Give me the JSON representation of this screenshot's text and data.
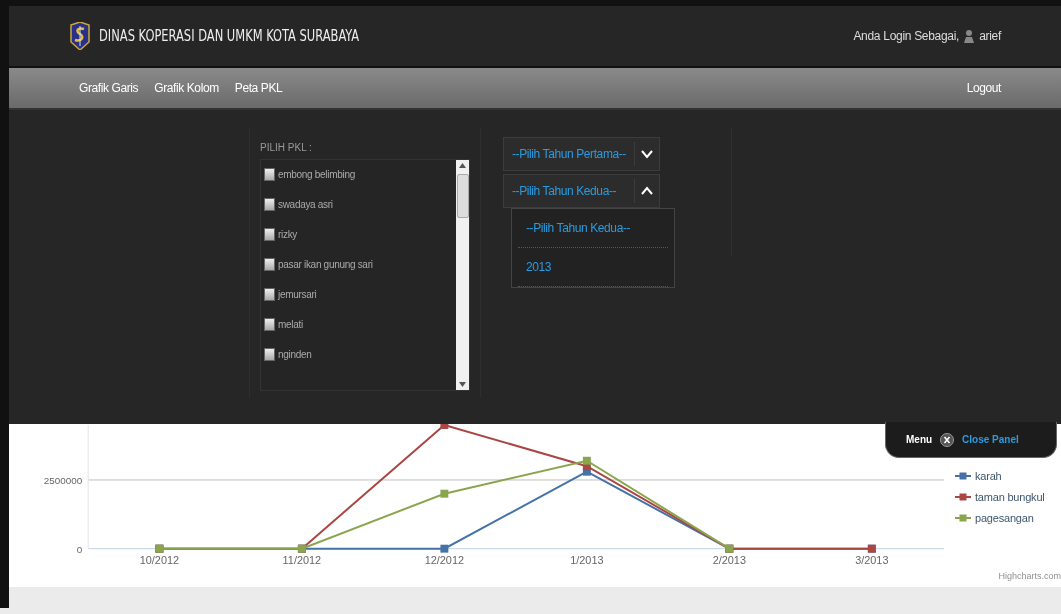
{
  "header": {
    "title": "DINAS KOPERASI DAN UMKM KOTA SURABAYA",
    "login_label": "Anda Login Sebagai,",
    "username": "arief"
  },
  "nav": {
    "items": [
      "Grafik Garis",
      "Grafik Kolom",
      "Peta PKL"
    ],
    "logout": "Logout"
  },
  "pkl_picker": {
    "label": "PILIH PKL :",
    "items": [
      {
        "label": "embong belimbing",
        "checked": false
      },
      {
        "label": "swadaya asri",
        "checked": false
      },
      {
        "label": "rizky",
        "checked": false
      },
      {
        "label": "pasar ikan gunung sari",
        "checked": false
      },
      {
        "label": "jemursari",
        "checked": false
      },
      {
        "label": "melati",
        "checked": false
      },
      {
        "label": "nginden",
        "checked": false
      }
    ]
  },
  "year_selects": [
    {
      "value": "--Pilih Tahun Pertama--",
      "expanded": false
    },
    {
      "value": "--Pilih Tahun Kedua--",
      "expanded": true,
      "options": [
        "--Pilih Tahun Kedua--",
        "2013"
      ]
    }
  ],
  "panel_tab": {
    "menu": "Menu",
    "close": "Close Panel"
  },
  "chart": {
    "credit": "Highcharts.com",
    "chart_data": {
      "type": "line",
      "categories": [
        "10/2012",
        "11/2012",
        "12/2012",
        "1/2013",
        "2/2013",
        "3/2013"
      ],
      "ylim": [
        0,
        4500000
      ],
      "yticks": [
        0,
        2500000
      ],
      "series": [
        {
          "name": "karah",
          "color": "#4572a7",
          "marker": "square",
          "values": [
            0,
            0,
            0,
            2800000,
            0,
            0
          ]
        },
        {
          "name": "taman bungkul",
          "color": "#aa4643",
          "marker": "square",
          "values": [
            0,
            0,
            4500000,
            3000000,
            0,
            0
          ]
        },
        {
          "name": "pagesangan",
          "color": "#89a54e",
          "marker": "square",
          "values": [
            0,
            0,
            2000000,
            3200000,
            0,
            null
          ]
        }
      ]
    }
  }
}
